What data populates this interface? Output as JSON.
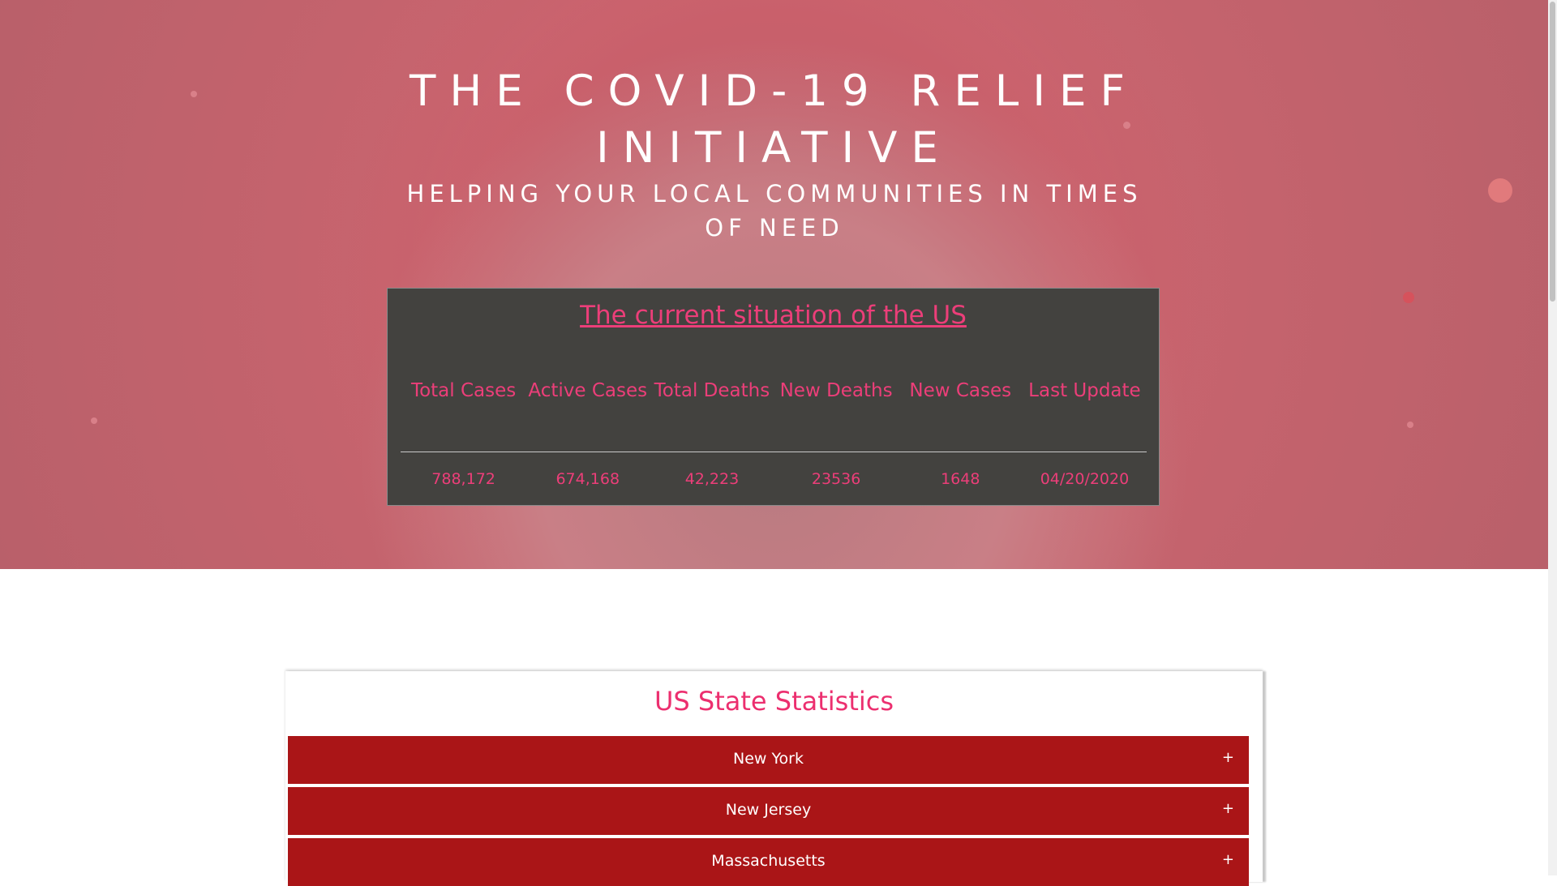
{
  "hero": {
    "title_line1": "THE COVID-19 RELIEF",
    "title_line2": "INITIATIVE",
    "subtitle": "HELPING YOUR LOCAL COMMUNITIES IN TIMES OF NEED"
  },
  "situation": {
    "title": "The current situation of the US",
    "headers": [
      "Total Cases",
      "Active Cases",
      "Total Deaths",
      "New Deaths",
      "New Cases",
      "Last Update"
    ],
    "values": [
      "788,172",
      "674,168",
      "42,223",
      "23536",
      "1648",
      "04/20/2020"
    ]
  },
  "states": {
    "title": "US State Statistics",
    "items": [
      {
        "name": "New York",
        "toggle": "+"
      },
      {
        "name": "New Jersey",
        "toggle": "+"
      },
      {
        "name": "Massachusetts",
        "toggle": "+"
      }
    ]
  },
  "colors": {
    "hero_tint": "#c8646e",
    "accent_pink": "#ec3e79",
    "panel_dark": "#43423f",
    "state_red": "#aa1517"
  }
}
